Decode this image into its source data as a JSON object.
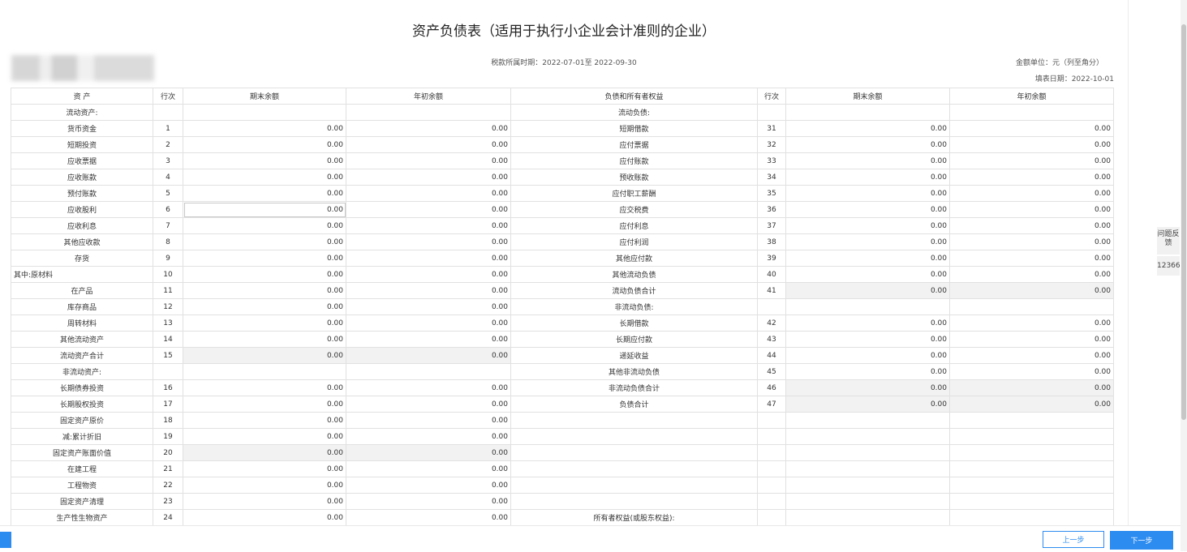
{
  "report": {
    "title": "资产负债表（适用于执行小企业会计准则的企业）",
    "period": "税款所属时期：2022-07-01至 2022-09-30",
    "unit": "金额单位：元（列至角分）",
    "fill_date": "填表日期：2022-10-01"
  },
  "table": {
    "headers": [
      "资 产",
      "行次",
      "期末余额",
      "年初余额",
      "负债和所有者权益",
      "行次",
      "期末余额",
      "年初余额"
    ],
    "rows": [
      [
        "流动资产:",
        "",
        "",
        "",
        "流动负债:",
        "",
        "",
        ""
      ],
      [
        "货币资金",
        "1",
        "0.00",
        "0.00",
        "短期借款",
        "31",
        "0.00",
        "0.00"
      ],
      [
        "短期投资",
        "2",
        "0.00",
        "0.00",
        "应付票据",
        "32",
        "0.00",
        "0.00"
      ],
      [
        "应收票据",
        "3",
        "0.00",
        "0.00",
        "应付账款",
        "33",
        "0.00",
        "0.00"
      ],
      [
        "应收账款",
        "4",
        "0.00",
        "0.00",
        "预收账款",
        "34",
        "0.00",
        "0.00"
      ],
      [
        "预付账款",
        "5",
        "0.00",
        "0.00",
        "应付职工薪酬",
        "35",
        "0.00",
        "0.00"
      ],
      [
        "应收股利",
        "6",
        "0.00",
        "0.00",
        "应交税费",
        "36",
        "0.00",
        "0.00"
      ],
      [
        "应收利息",
        "7",
        "0.00",
        "0.00",
        "应付利息",
        "37",
        "0.00",
        "0.00"
      ],
      [
        "其他应收款",
        "8",
        "0.00",
        "0.00",
        "应付利润",
        "38",
        "0.00",
        "0.00"
      ],
      [
        "存货",
        "9",
        "0.00",
        "0.00",
        "其他应付款",
        "39",
        "0.00",
        "0.00"
      ],
      [
        "其中:原材料",
        "10",
        "0.00",
        "0.00",
        "其他流动负债",
        "40",
        "0.00",
        "0.00"
      ],
      [
        "在产品",
        "11",
        "0.00",
        "0.00",
        "流动负债合计",
        "41",
        "0.00",
        "0.00"
      ],
      [
        "库存商品",
        "12",
        "0.00",
        "0.00",
        "非流动负债:",
        "",
        "",
        ""
      ],
      [
        "周转材料",
        "13",
        "0.00",
        "0.00",
        "长期借款",
        "42",
        "0.00",
        "0.00"
      ],
      [
        "其他流动资产",
        "14",
        "0.00",
        "0.00",
        "长期应付款",
        "43",
        "0.00",
        "0.00"
      ],
      [
        "流动资产合计",
        "15",
        "0.00",
        "0.00",
        "递延收益",
        "44",
        "0.00",
        "0.00"
      ],
      [
        "非流动资产:",
        "",
        "",
        "",
        "其他非流动负债",
        "45",
        "0.00",
        "0.00"
      ],
      [
        "长期债券投资",
        "16",
        "0.00",
        "0.00",
        "非流动负债合计",
        "46",
        "0.00",
        "0.00"
      ],
      [
        "长期股权投资",
        "17",
        "0.00",
        "0.00",
        "负债合计",
        "47",
        "0.00",
        "0.00"
      ],
      [
        "固定资产原价",
        "18",
        "0.00",
        "0.00",
        "",
        "",
        "",
        ""
      ],
      [
        "减:累计折旧",
        "19",
        "0.00",
        "0.00",
        "",
        "",
        "",
        ""
      ],
      [
        "固定资产账面价值",
        "20",
        "0.00",
        "0.00",
        "",
        "",
        "",
        ""
      ],
      [
        "在建工程",
        "21",
        "0.00",
        "0.00",
        "",
        "",
        "",
        ""
      ],
      [
        "工程物资",
        "22",
        "0.00",
        "0.00",
        "",
        "",
        "",
        ""
      ],
      [
        "固定资产清理",
        "23",
        "0.00",
        "0.00",
        "",
        "",
        "",
        ""
      ],
      [
        "生产性生物资产",
        "24",
        "0.00",
        "0.00",
        "所有者权益(或股东权益):",
        "",
        "",
        ""
      ]
    ]
  },
  "side": {
    "feedback": "问题反馈",
    "hotline": "12366"
  },
  "footer": {
    "prev_label": "上一步",
    "next_label": "下一步"
  },
  "colors": {
    "accent": "#2d8cf0",
    "computed_cell_bg": "#f2f2f2",
    "border": "#e1e1e1"
  }
}
